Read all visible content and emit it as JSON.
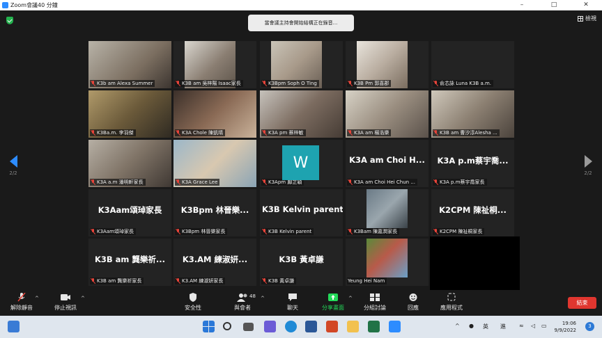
{
  "window": {
    "title": "Zoom會議40 分鐘"
  },
  "notice": {
    "text": "當會議主持會開始結構正在錄音..."
  },
  "view": {
    "label": "檢視"
  },
  "pager": {
    "left": "2/2",
    "right": "2/2"
  },
  "tiles": [
    {
      "label": "K3b am Alexa Summer",
      "name": "",
      "video": true
    },
    {
      "label": "K3B am 吳梓陽 Isaac家長",
      "name": "",
      "video": true
    },
    {
      "label": "K3Bpm Soph O Ting",
      "name": "",
      "video": true
    },
    {
      "label": "K3B Pm 郭喜郡",
      "name": "",
      "video": true
    },
    {
      "label": "俞芯詠 Luna K3B a.m.",
      "name": "",
      "video": false
    },
    {
      "label": "K3Ba.m. 李羽傑",
      "name": "",
      "video": true
    },
    {
      "label": "K3A Chole 陳凱晴",
      "name": "",
      "video": true
    },
    {
      "label": "K3A pm 蔡梓敏",
      "name": "",
      "video": true
    },
    {
      "label": "K3A am 楊浩樂",
      "name": "",
      "video": true
    },
    {
      "label": "K3B am 曹汐淳Alesha ...",
      "name": "",
      "video": true
    },
    {
      "label": "K3A a.m 潘明軒家長",
      "name": "",
      "video": true
    },
    {
      "label": "K3A Grace Lee",
      "name": "",
      "video": true
    },
    {
      "label": "K3Apm 鄺芷穎",
      "name": "",
      "video": false
    },
    {
      "label": "K3A am Choi Hei Chun ...",
      "name": "K3A am Choi H...",
      "video": false
    },
    {
      "label": "K3A p.m蔡宇喬家長",
      "name": "K3A p.m蔡宇喬...",
      "video": false
    },
    {
      "label": "K3Aam頌琸家長",
      "name": "K3Aam頌琸家長",
      "video": false
    },
    {
      "label": "K3Bpm 林晉樂家長",
      "name": "K3Bpm 林晉樂...",
      "video": false
    },
    {
      "label": "K3B Kelvin parent",
      "name": "K3B Kelvin parent",
      "video": false
    },
    {
      "label": "K3Bam 陳嘉潤家長",
      "name": "",
      "video": true
    },
    {
      "label": "K2CPM 陳祉桐家長",
      "name": "K2CPM 陳祉桐...",
      "video": false
    },
    {
      "label": "K3B am 龔樂祈家長",
      "name": "K3B am 龔樂祈...",
      "video": false
    },
    {
      "label": "K3.AM 練淑妍家長",
      "name": "K3.AM 練淑妍...",
      "video": false
    },
    {
      "label": "K3B 黃卓謙",
      "name": "K3B 黃卓謙",
      "video": false
    },
    {
      "label": "Yeung Hei Nam",
      "name": "",
      "video": true
    }
  ],
  "avatar_letter": "W",
  "toolbar": {
    "mute": "解除靜音",
    "video": "停止視訊",
    "security": "安全性",
    "participants": "與會者",
    "participants_count": "48",
    "chat": "聊天",
    "share": "分享畫面",
    "breakout": "分組討論",
    "reactions": "回應",
    "apps": "應用程式",
    "end": "結束"
  },
  "taskbar": {
    "ime": "英",
    "ime2": "進",
    "time": "19:06",
    "date": "9/9/2022",
    "notif_count": "3"
  },
  "colors": {
    "zoom_blue": "#2d8cff",
    "end_red": "#e0362f",
    "share_green": "#23d959",
    "muted_red": "#e8443a"
  }
}
